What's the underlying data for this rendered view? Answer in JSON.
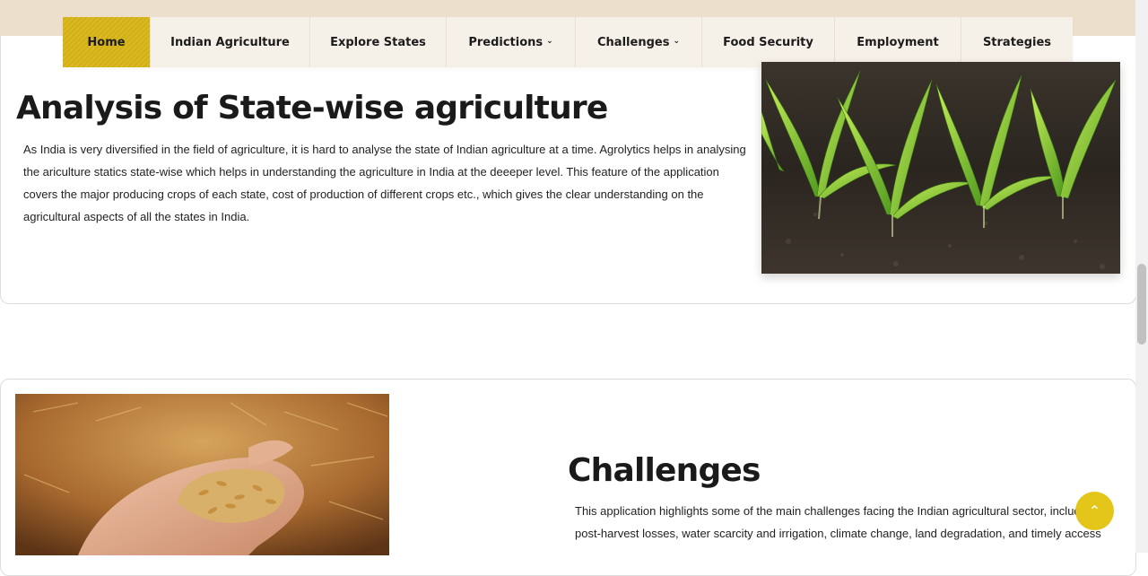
{
  "nav": {
    "items": [
      {
        "label": "Home",
        "active": true,
        "has_dropdown": false
      },
      {
        "label": "Indian Agriculture",
        "active": false,
        "has_dropdown": false
      },
      {
        "label": "Explore States",
        "active": false,
        "has_dropdown": false
      },
      {
        "label": "Predictions",
        "active": false,
        "has_dropdown": true
      },
      {
        "label": "Challenges",
        "active": false,
        "has_dropdown": true
      },
      {
        "label": "Food Security",
        "active": false,
        "has_dropdown": false
      },
      {
        "label": "Employment",
        "active": false,
        "has_dropdown": false
      },
      {
        "label": "Strategies",
        "active": false,
        "has_dropdown": false
      }
    ],
    "chevron_icon": "chevron-down-icon",
    "active_color": "#d8b516",
    "background_color": "#f6f1e8"
  },
  "state_analysis": {
    "title": "Analysis of State-wise agriculture",
    "description": "As India is very diversified in the field of agriculture, it is hard to analyse the state of Indian agriculture at a time. Agrolytics helps in analysing the ariculture statics state-wise which helps in understanding the agriculture in India at the deeeper level. This feature of the application covers the major producing crops of each state, cost of production of different crops etc., which gives the clear understanding on the agricultural aspects of all the states in India.",
    "image": "corn-seedlings-photo"
  },
  "challenges": {
    "title": "Challenges",
    "description": "This application highlights some of the main challenges facing the Indian agricultural sector, including post-harvest losses, water scarcity and irrigation, climate change, land degradation, and timely access",
    "image": "hand-holding-rice-grains-photo"
  },
  "back_to_top": {
    "icon": "chevron-up-icon",
    "glyph": "⌃",
    "color": "#e4c51a"
  },
  "page": {
    "band_color": "#ecdfcc"
  }
}
